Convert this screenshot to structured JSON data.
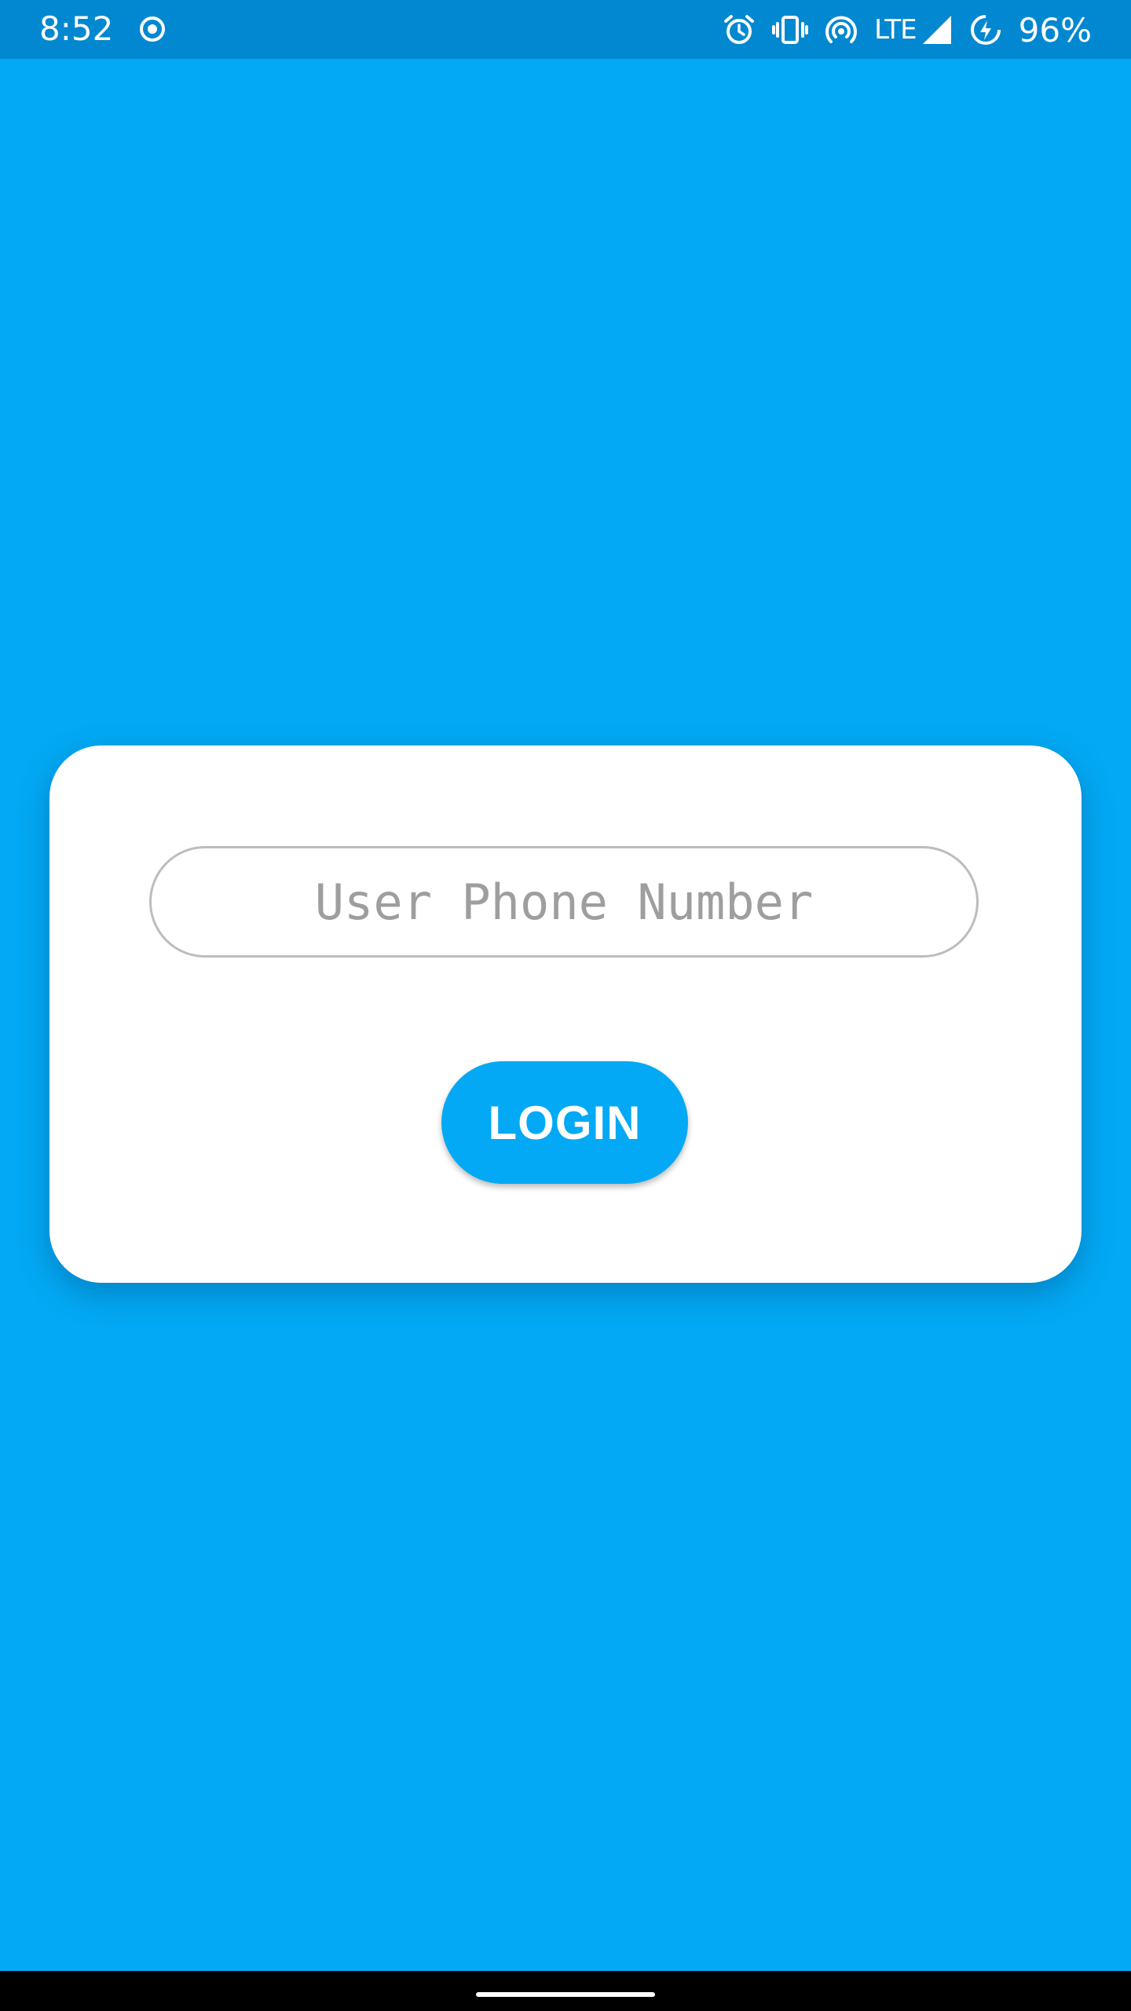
{
  "status_bar": {
    "time": "8:52",
    "left_icon": "record-circle-icon",
    "icons": [
      "alarm-icon",
      "vibrate-icon",
      "hotspot-icon",
      "signal-icon",
      "battery-saver-icon"
    ],
    "network": "LTE",
    "battery": "96%"
  },
  "login_card": {
    "phone_input": {
      "placeholder": "User Phone Number",
      "value": ""
    },
    "login_button_label": "LOGIN"
  },
  "colors": {
    "background": "#03A9F4",
    "status_bar": "#0288D1",
    "card": "#FFFFFF",
    "button": "#03A9F4",
    "input_border": "#BDBDBD",
    "placeholder": "#9E9E9E"
  }
}
